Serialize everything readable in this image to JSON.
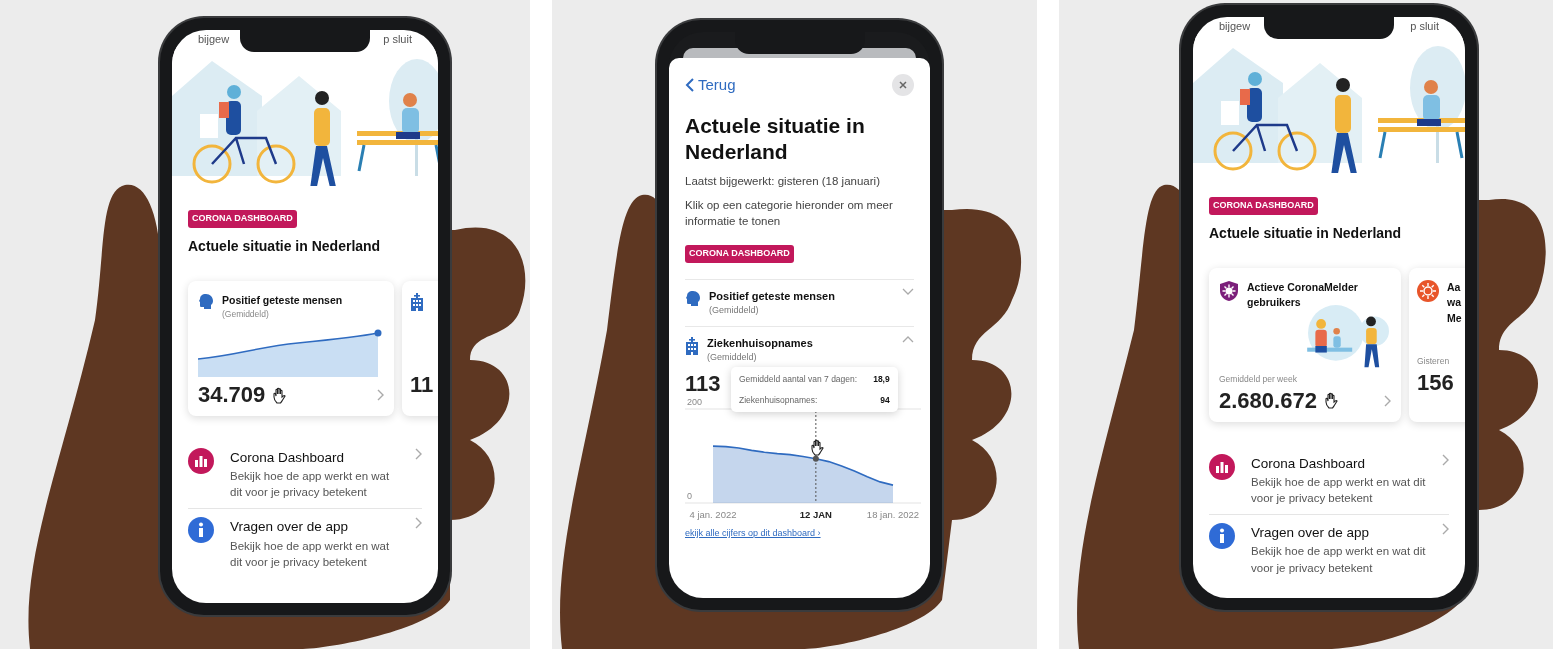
{
  "phones": [
    {
      "kind": "home",
      "status_left": "bijgew",
      "status_right": "p sluit",
      "tag": "CORONA DASHBOARD",
      "heading": "Actuele situatie in Nederland",
      "cards": [
        {
          "kind": "chart",
          "title": "Positief geteste mensen",
          "subtitle": "(Gemiddeld)",
          "value": "34.709",
          "cursor": true
        },
        {
          "kind": "chart",
          "value": "11",
          "cursor": false
        }
      ],
      "links": [
        {
          "title": "Corona Dashboard",
          "text": "Bekijk hoe de app werkt en wat dit voor je privacy betekent"
        },
        {
          "title": "Vragen over de app",
          "text": "Bekijk hoe de app werkt en wat dit voor je privacy betekent"
        }
      ]
    },
    {
      "kind": "detail",
      "back": "Terug",
      "heading": "Actuele situatie in Nederland",
      "updated": "Laatst bijgewerkt: gisteren (18 januari)",
      "instruction": "Klik op een categorie hieronder om meer informatie te tonen",
      "tag": "CORONA DASHBOARD",
      "sections": [
        {
          "title": "Positief geteste mensen",
          "subtitle": "(Gemiddeld)",
          "expanded": false
        },
        {
          "title": "Ziekenhuisopnames",
          "subtitle": "(Gemiddeld)",
          "expanded": true,
          "value": "113",
          "tooltip": [
            {
              "label": "Gemiddeld aantal van 7 dagen:",
              "value": "18,9"
            },
            {
              "label": "Ziekenhuisopnames:",
              "value": "94"
            }
          ],
          "chart_data": {
            "type": "area",
            "categories": [
              "4 jan. 2022",
              null,
              null,
              null,
              null,
              null,
              null,
              null,
              "12 JAN",
              null,
              null,
              null,
              null,
              null,
              "18 jan. 2022"
            ],
            "ylim": [
              0,
              200
            ],
            "yticks": [
              {
                "value": 0,
                "label": "0"
              },
              {
                "value": 200,
                "label": "200"
              }
            ],
            "series": [
              {
                "color": "#2f6bc0",
                "values": [
                  121,
                  120,
                  117,
                  112,
                  108,
                  105,
                  103,
                  99,
                  94,
                  88,
                  79,
                  68,
                  56,
                  45,
                  38
                ]
              }
            ],
            "annotations": [
              {
                "x": "12 JAN"
              }
            ]
          }
        }
      ],
      "footer_link": "ekijk alle cijfers op dit dashboard ›"
    },
    {
      "kind": "home",
      "status_left": "bijgew",
      "status_right": "p sluit",
      "tag": "CORONA DASHBOARD",
      "heading": "Actuele situatie in Nederland",
      "cards": [
        {
          "kind": "illustration",
          "title": "Actieve CoronaMelder gebruikers",
          "caption": "Gemiddeld per week",
          "value": "2.680.672",
          "cursor": true
        },
        {
          "kind": "illustration",
          "title_lines": [
            "Aa",
            "wa",
            "Me"
          ],
          "caption": "Gisteren",
          "value": "156",
          "cursor": false
        }
      ],
      "links": [
        {
          "title": "Corona Dashboard",
          "text": "Bekijk hoe de app werkt en wat dit voor je privacy betekent"
        },
        {
          "title": "Vragen over de app",
          "text": "Bekijk hoe de app werkt en wat dit voor je privacy betekent"
        }
      ]
    }
  ]
}
